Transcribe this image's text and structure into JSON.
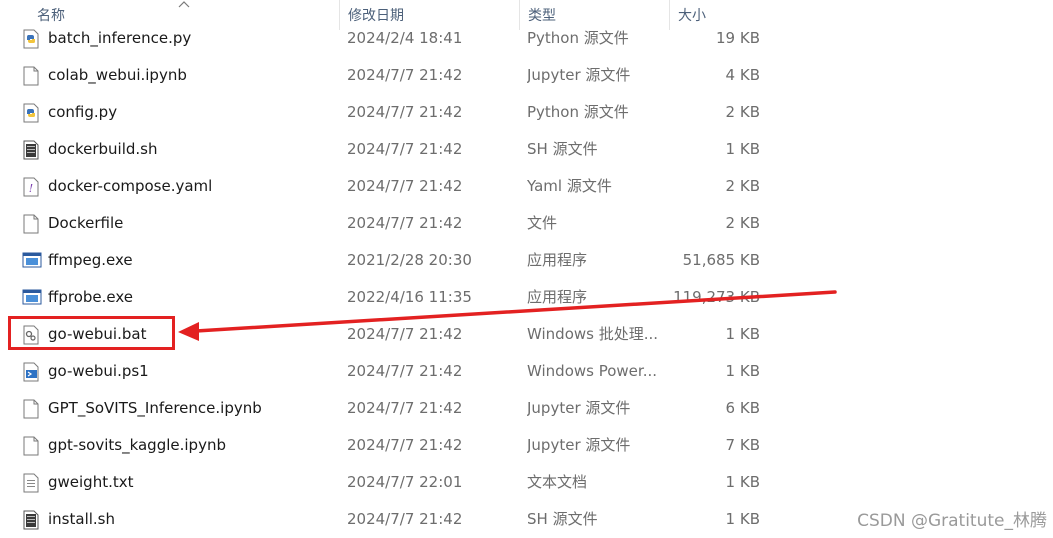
{
  "columns": {
    "name": "名称",
    "modified": "修改日期",
    "type": "类型",
    "size": "大小"
  },
  "files": [
    {
      "name": "batch_inference.py",
      "modified": "2024/2/4 18:41",
      "type": "Python 源文件",
      "size": "19 KB",
      "icon": "python-file-icon"
    },
    {
      "name": "colab_webui.ipynb",
      "modified": "2024/7/7 21:42",
      "type": "Jupyter 源文件",
      "size": "4 KB",
      "icon": "document-file-icon"
    },
    {
      "name": "config.py",
      "modified": "2024/7/7 21:42",
      "type": "Python 源文件",
      "size": "2 KB",
      "icon": "python-file-icon"
    },
    {
      "name": "dockerbuild.sh",
      "modified": "2024/7/7 21:42",
      "type": "SH 源文件",
      "size": "1 KB",
      "icon": "shell-file-icon"
    },
    {
      "name": "docker-compose.yaml",
      "modified": "2024/7/7 21:42",
      "type": "Yaml 源文件",
      "size": "2 KB",
      "icon": "yaml-file-icon"
    },
    {
      "name": "Dockerfile",
      "modified": "2024/7/7 21:42",
      "type": "文件",
      "size": "2 KB",
      "icon": "blank-file-icon"
    },
    {
      "name": "ffmpeg.exe",
      "modified": "2021/2/28 20:30",
      "type": "应用程序",
      "size": "51,685 KB",
      "icon": "application-icon"
    },
    {
      "name": "ffprobe.exe",
      "modified": "2022/4/16 11:35",
      "type": "应用程序",
      "size": "119,273 KB",
      "icon": "application-icon"
    },
    {
      "name": "go-webui.bat",
      "modified": "2024/7/7 21:42",
      "type": "Windows 批处理...",
      "size": "1 KB",
      "icon": "batch-file-icon"
    },
    {
      "name": "go-webui.ps1",
      "modified": "2024/7/7 21:42",
      "type": "Windows Power...",
      "size": "1 KB",
      "icon": "powershell-file-icon"
    },
    {
      "name": "GPT_SoVITS_Inference.ipynb",
      "modified": "2024/7/7 21:42",
      "type": "Jupyter 源文件",
      "size": "6 KB",
      "icon": "document-file-icon"
    },
    {
      "name": "gpt-sovits_kaggle.ipynb",
      "modified": "2024/7/7 21:42",
      "type": "Jupyter 源文件",
      "size": "7 KB",
      "icon": "document-file-icon"
    },
    {
      "name": "gweight.txt",
      "modified": "2024/7/7 22:01",
      "type": "文本文档",
      "size": "1 KB",
      "icon": "text-file-icon"
    },
    {
      "name": "install.sh",
      "modified": "2024/7/7 21:42",
      "type": "SH 源文件",
      "size": "1 KB",
      "icon": "shell-file-icon"
    }
  ],
  "annotation": {
    "color": "#e32121",
    "target": "go-webui.bat"
  },
  "watermark": "CSDN @Gratitute_林腾"
}
